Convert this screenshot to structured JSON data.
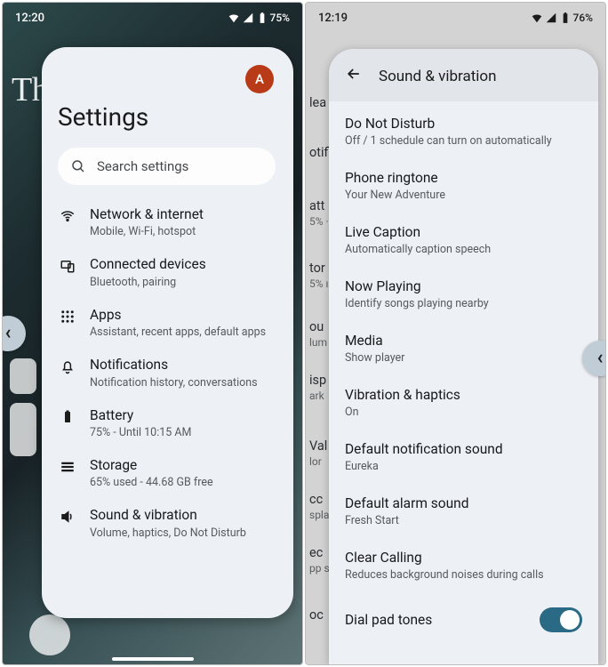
{
  "phone1": {
    "time": "12:20",
    "battery": "75%",
    "bg_word": "Th",
    "avatar_initial": "A",
    "title": "Settings",
    "search_placeholder": "Search settings",
    "items": [
      {
        "title": "Network & internet",
        "subtitle": "Mobile, Wi-Fi, hotspot"
      },
      {
        "title": "Connected devices",
        "subtitle": "Bluetooth, pairing"
      },
      {
        "title": "Apps",
        "subtitle": "Assistant, recent apps, default apps"
      },
      {
        "title": "Notifications",
        "subtitle": "Notification history, conversations"
      },
      {
        "title": "Battery",
        "subtitle": "75% - Until 10:15 AM"
      },
      {
        "title": "Storage",
        "subtitle": "65% used - 44.68 GB free"
      },
      {
        "title": "Sound & vibration",
        "subtitle": "Volume, haptics, Do Not Disturb"
      }
    ]
  },
  "phone2": {
    "time": "12:19",
    "battery": "76%",
    "header": "Sound & vibration",
    "peek": [
      {
        "t": "lea",
        "s": ""
      },
      {
        "t": "otifi",
        "s": ""
      },
      {
        "t": "att",
        "s": "5% ·"
      },
      {
        "t": "tor",
        "s": "5% ı"
      },
      {
        "t": "ou",
        "s": "lum"
      },
      {
        "t": "isp",
        "s": "ark "
      },
      {
        "t": "Val",
        "s": "lor"
      },
      {
        "t": "cc",
        "s": "spla"
      },
      {
        "t": "ec",
        "s": "pp s"
      },
      {
        "t": "oc",
        "s": ""
      }
    ],
    "items": [
      {
        "title": "Do Not Disturb",
        "subtitle": "Off / 1 schedule can turn on automatically"
      },
      {
        "title": "Phone ringtone",
        "subtitle": "Your New Adventure"
      },
      {
        "title": "Live Caption",
        "subtitle": "Automatically caption speech"
      },
      {
        "title": "Now Playing",
        "subtitle": "Identify songs playing nearby"
      },
      {
        "title": "Media",
        "subtitle": "Show player"
      },
      {
        "title": "Vibration & haptics",
        "subtitle": "On"
      },
      {
        "title": "Default notification sound",
        "subtitle": "Eureka"
      },
      {
        "title": "Default alarm sound",
        "subtitle": "Fresh Start"
      },
      {
        "title": "Clear Calling",
        "subtitle": "Reduces background noises during calls"
      }
    ],
    "toggle_item": {
      "title": "Dial pad tones",
      "on": true
    }
  }
}
